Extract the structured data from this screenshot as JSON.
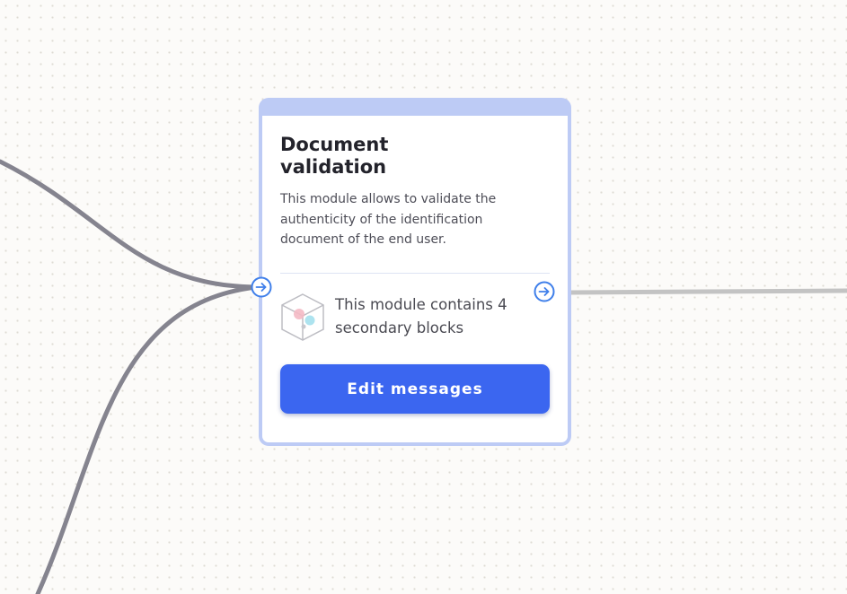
{
  "canvas": {
    "background_color": "#fcfbf9",
    "dot_color": "#dedbd4"
  },
  "connectors": {
    "incoming_color": "#85848f",
    "outgoing_color": "#c3c3c3"
  },
  "module_card": {
    "title": "Document validation",
    "description": "This module allows to validate the authenticity of the identification document of the end user.",
    "secondary_blocks_text": "This module contains 4 secondary blocks",
    "edit_button_label": "Edit messages",
    "header_color": "#bdcbf5",
    "accent_color": "#3b66f0",
    "input_port_icon": "arrow-right-circle-icon",
    "output_port_icon": "arrow-right-circle-icon",
    "blocks_icon": "cube-icon"
  }
}
